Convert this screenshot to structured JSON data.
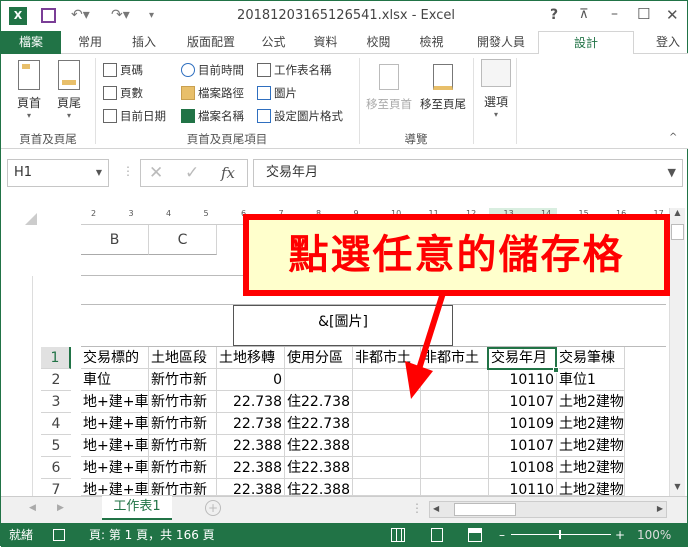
{
  "title": "20181203165126541.xlsx - Excel",
  "window_controls": {
    "help": "?",
    "restore_ribbon": "⊼",
    "minimize": "–",
    "maximize": "☐",
    "close": "✕"
  },
  "tabs": [
    {
      "label": "檔案"
    },
    {
      "label": "常用"
    },
    {
      "label": "插入"
    },
    {
      "label": "版面配置"
    },
    {
      "label": "公式"
    },
    {
      "label": "資料"
    },
    {
      "label": "校閱"
    },
    {
      "label": "檢視"
    },
    {
      "label": "開發人員"
    },
    {
      "label": "設計",
      "active": true
    }
  ],
  "signin": "登入",
  "ribbon": {
    "header_footer": {
      "header": "頁首",
      "footer": "頁尾",
      "group": "頁首及頁尾"
    },
    "elements": {
      "page_number": "頁碼",
      "page_count": "頁數",
      "current_date": "目前日期",
      "current_time": "目前時間",
      "file_path": "檔案路徑",
      "file_name": "檔案名稱",
      "sheet_name": "工作表名稱",
      "picture": "圖片",
      "format_picture": "設定圖片格式",
      "group": "頁首及頁尾項目"
    },
    "navigation": {
      "goto_header": "移至頁首",
      "goto_footer": "移至頁尾",
      "group": "導覽"
    },
    "options": {
      "label": "選項"
    }
  },
  "formula_bar": {
    "name_box": "H1",
    "value": "交易年月",
    "cancel": "✕",
    "enter": "✓",
    "fx": "fx"
  },
  "ruler": [
    "2",
    "3",
    "4",
    "5",
    "6",
    "7",
    "8",
    "9",
    "10",
    "11",
    "12",
    "13",
    "14",
    "15",
    "16",
    "17"
  ],
  "columns": [
    "B",
    "C"
  ],
  "header_picture": "&[圖片]",
  "callout": "點選任意的儲存格",
  "rows": [
    {
      "n": "1",
      "cells": [
        "交易標的",
        "土地區段",
        "土地移轉",
        "使用分區",
        "非都市土",
        "非都市土",
        "交易年月",
        "交易筆棟"
      ]
    },
    {
      "n": "2",
      "cells": [
        "車位",
        "新竹市新",
        "0",
        "",
        "",
        "",
        "10110",
        "車位1"
      ]
    },
    {
      "n": "3",
      "cells": [
        "地+建+車",
        "新竹市新",
        "22.738",
        "住22.738",
        "",
        "",
        "10107",
        "土地2建物"
      ]
    },
    {
      "n": "4",
      "cells": [
        "地+建+車",
        "新竹市新",
        "22.738",
        "住22.738",
        "",
        "",
        "10109",
        "土地2建物"
      ]
    },
    {
      "n": "5",
      "cells": [
        "地+建+車",
        "新竹市新",
        "22.388",
        "住22.388",
        "",
        "",
        "10107",
        "土地2建物"
      ]
    },
    {
      "n": "6",
      "cells": [
        "地+建+車",
        "新竹市新",
        "22.388",
        "住22.388",
        "",
        "",
        "10108",
        "土地2建物"
      ]
    },
    {
      "n": "7",
      "cells": [
        "地+建+車",
        "新竹市新",
        "22.388",
        "住22.388",
        "",
        "",
        "10110",
        "土地2建物"
      ]
    }
  ],
  "sheet_tab": "工作表1",
  "status": {
    "ready": "就緒",
    "page": "頁: 第 1 頁，共 166 頁",
    "zoom": "100%"
  },
  "colors": {
    "excel_green": "#217346",
    "callout_red": "#ff0000",
    "callout_bg": "#ffffcc"
  }
}
